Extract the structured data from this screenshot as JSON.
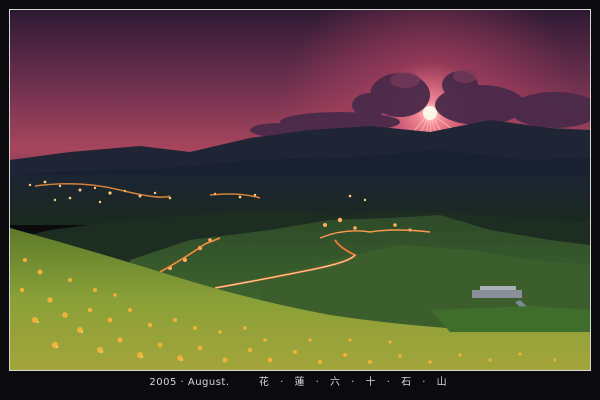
{
  "caption": {
    "year_text": "2005 · August.",
    "location_text": "花 · 蓮 · 六 · 十 · 石 · 山"
  },
  "colors": {
    "border": "#d8d8d8",
    "background": "#0b0b0d",
    "sky_top": "#3a1d3a",
    "sky_glow": "#c85a72",
    "sun": "#fff2d6",
    "lily": "#e0a530"
  }
}
